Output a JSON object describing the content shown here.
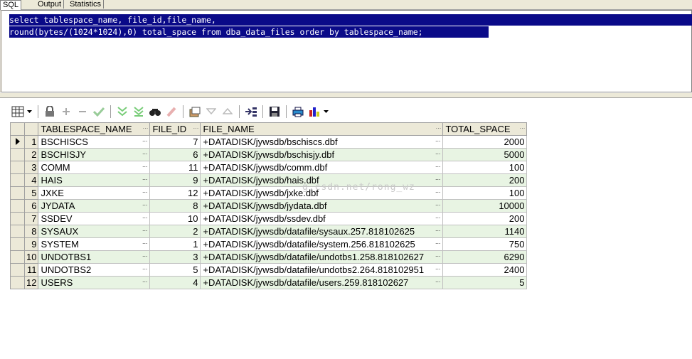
{
  "tabs": [
    "SQL",
    "Output",
    "Statistics"
  ],
  "editor": {
    "lines": [
      "select tablespace_name, file_id,file_name,",
      "round(bytes/(1024*1024),0) total_space from dba_data_files order by tablespace_name;"
    ]
  },
  "toolbar": {
    "icons": [
      "grid-view-icon",
      "lock-icon",
      "add-record-icon",
      "delete-record-icon",
      "post-edit-icon",
      "fetch-next-icon",
      "fetch-last-icon",
      "find-icon",
      "clear-icon",
      "query-by-example-icon",
      "filter-down-icon",
      "filter-up-icon",
      "export-icon",
      "save-icon",
      "print-icon",
      "chart-icon"
    ]
  },
  "grid": {
    "columns": [
      "TABLESPACE_NAME",
      "FILE_ID",
      "FILE_NAME",
      "TOTAL_SPACE"
    ],
    "rows": [
      {
        "n": "1",
        "ts": "BSCHISCS",
        "id": "7",
        "file": "+DATADISK/jywsdb/bschiscs.dbf",
        "total": "2000"
      },
      {
        "n": "2",
        "ts": "BSCHISJY",
        "id": "6",
        "file": "+DATADISK/jywsdb/bschisjy.dbf",
        "total": "5000"
      },
      {
        "n": "3",
        "ts": "COMM",
        "id": "11",
        "file": "+DATADISK/jywsdb/comm.dbf",
        "total": "100"
      },
      {
        "n": "4",
        "ts": "HAIS",
        "id": "9",
        "file": "+DATADISK/jywsdb/hais.dbf",
        "total": "200"
      },
      {
        "n": "5",
        "ts": "JXKE",
        "id": "12",
        "file": "+DATADISK/jywsdb/jxke.dbf",
        "total": "100"
      },
      {
        "n": "6",
        "ts": "JYDATA",
        "id": "8",
        "file": "+DATADISK/jywsdb/jydata.dbf",
        "total": "10000"
      },
      {
        "n": "7",
        "ts": "SSDEV",
        "id": "10",
        "file": "+DATADISK/jywsdb/ssdev.dbf",
        "total": "200"
      },
      {
        "n": "8",
        "ts": "SYSAUX",
        "id": "2",
        "file": "+DATADISK/jywsdb/datafile/sysaux.257.818102625",
        "total": "1140"
      },
      {
        "n": "9",
        "ts": "SYSTEM",
        "id": "1",
        "file": "+DATADISK/jywsdb/datafile/system.256.818102625",
        "total": "750"
      },
      {
        "n": "10",
        "ts": "UNDOTBS1",
        "id": "3",
        "file": "+DATADISK/jywsdb/datafile/undotbs1.258.818102627",
        "total": "6290"
      },
      {
        "n": "11",
        "ts": "UNDOTBS2",
        "id": "5",
        "file": "+DATADISK/jywsdb/datafile/undotbs2.264.818102951",
        "total": "2400"
      },
      {
        "n": "12",
        "ts": "USERS",
        "id": "4",
        "file": "+DATADISK/jywsdb/datafile/users.259.818102627",
        "total": "5"
      }
    ]
  },
  "watermark": "g.csdn.net/rong_wz",
  "colors": {
    "selection": "#0a0a88",
    "row_alt": "#e8f4e3",
    "chrome": "#ece9d8"
  }
}
